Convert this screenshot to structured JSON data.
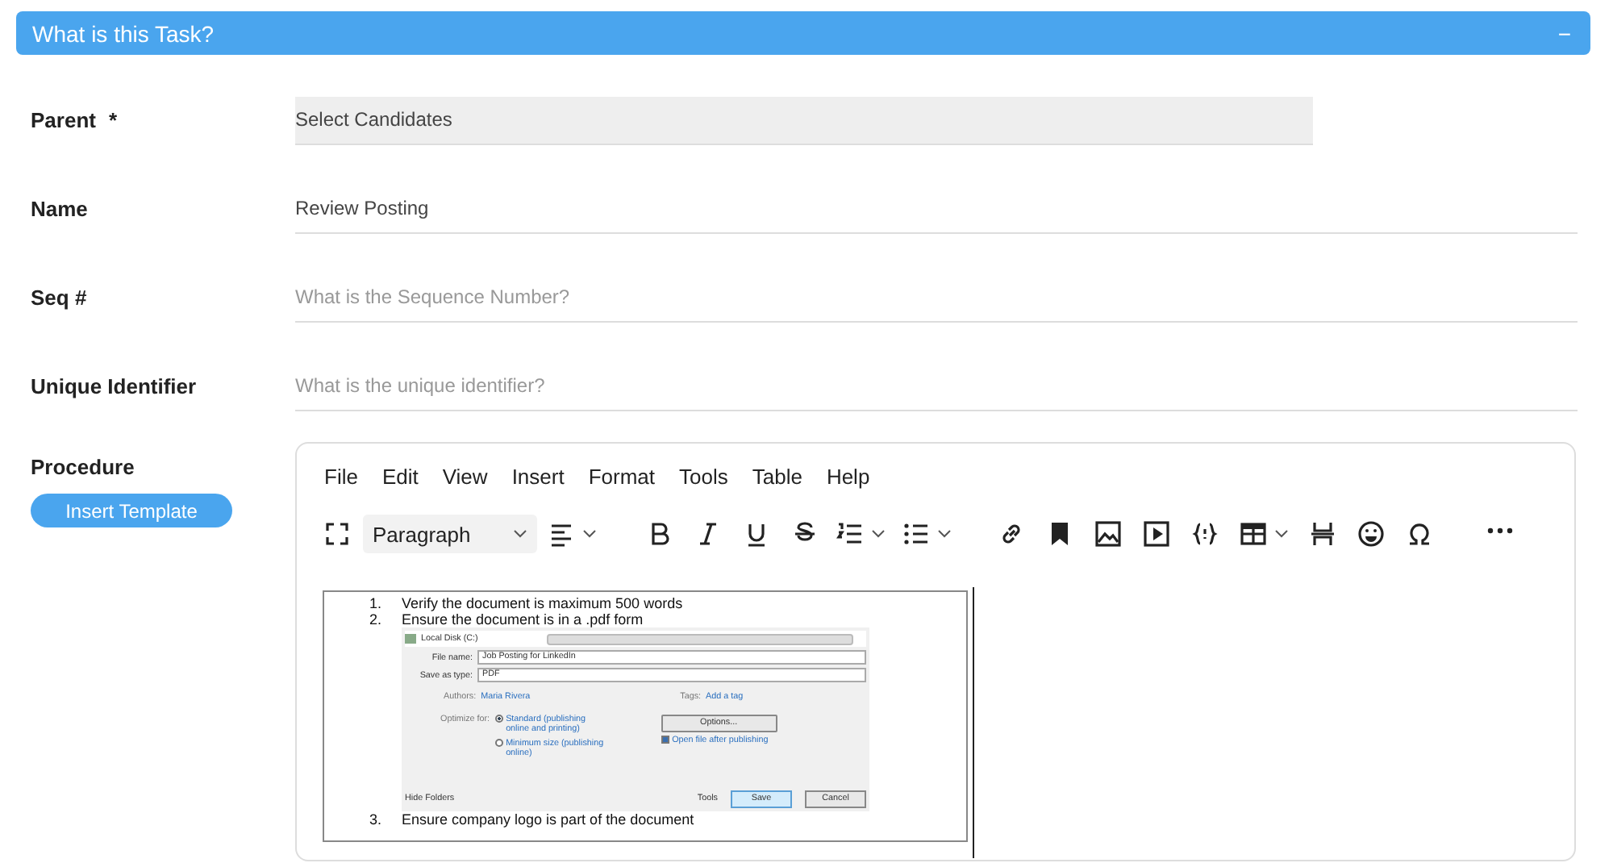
{
  "panel": {
    "title": "What is this Task?",
    "collapse_symbol": "−"
  },
  "fields": [
    {
      "label": "Parent",
      "required_mark": "*",
      "kind": "select",
      "value": "Select Candidates"
    },
    {
      "label": "Name",
      "kind": "text",
      "value": "Review Posting"
    },
    {
      "label": "Seq #",
      "kind": "text",
      "placeholder": "What is the Sequence Number?"
    },
    {
      "label": "Unique Identifier",
      "kind": "text",
      "placeholder": "What is the unique identifier?"
    }
  ],
  "procedure": {
    "label": "Procedure",
    "button": "Insert Template",
    "editor": {
      "menu": [
        "File",
        "Edit",
        "View",
        "Insert",
        "Format",
        "Tools",
        "Table",
        "Help"
      ],
      "block_format": "Paragraph",
      "content": {
        "items": [
          {
            "number": "1.",
            "text": "Verify the document is maximum 500 words"
          },
          {
            "number": "2.",
            "text": "Ensure the document is in a .pdf form"
          },
          {
            "number": "3.",
            "text": "Ensure company logo is part of the document"
          }
        ],
        "dialog": {
          "location": "Local Disk (C:)",
          "file_name_label": "File name:",
          "file_name": "Job Posting for LinkedIn",
          "type_label": "Save as type:",
          "type": "PDF",
          "authors_label": "Authors:",
          "authors": "Maria Rivera",
          "tags_label": "Tags:",
          "tags": "Add a tag",
          "optimize_label": "Optimize for:",
          "options": [
            {
              "text": "Standard (publishing online and printing)",
              "selected": true
            },
            {
              "text": "Minimum size (publishing online)",
              "selected": false
            }
          ],
          "options_button": "Options...",
          "open_after": {
            "text": "Open file after publishing",
            "checked": true
          },
          "hide_folders": "Hide Folders",
          "tools": "Tools",
          "save": "Save",
          "cancel": "Cancel"
        }
      }
    }
  }
}
